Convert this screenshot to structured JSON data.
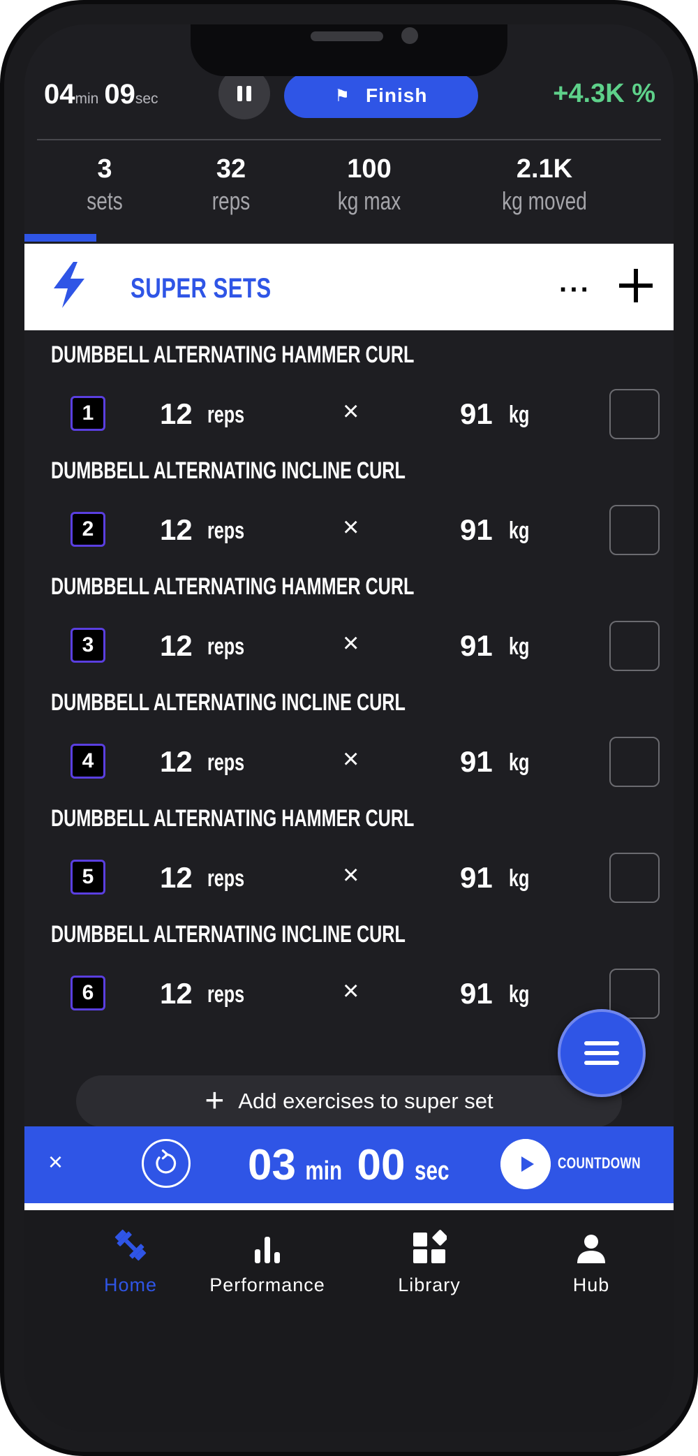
{
  "colors": {
    "accent": "#2f55e6",
    "positive": "#5ed18a",
    "background": "#1e1e22"
  },
  "topbar": {
    "timer_min": "04",
    "timer_min_unit": "min",
    "timer_sec": "09",
    "timer_sec_unit": "sec",
    "finish_label": "Finish",
    "percent": "+4.3K %"
  },
  "stats": [
    {
      "value": "3",
      "label": "sets"
    },
    {
      "value": "32",
      "label": "reps"
    },
    {
      "value": "100",
      "label": "kg max"
    },
    {
      "value": "2.1K",
      "label": "kg moved"
    }
  ],
  "section": {
    "title": "SUPER SETS",
    "more": "···"
  },
  "exercises": [
    {
      "title": "DUMBBELL ALTERNATING HAMMER CURL",
      "set": "1",
      "reps": "12",
      "reps_unit": "reps",
      "times": "×",
      "weight": "91",
      "weight_unit": "kg",
      "checked": false
    },
    {
      "title": "DUMBBELL ALTERNATING INCLINE CURL",
      "set": "2",
      "reps": "12",
      "reps_unit": "reps",
      "times": "×",
      "weight": "91",
      "weight_unit": "kg",
      "checked": false
    },
    {
      "title": "DUMBBELL ALTERNATING HAMMER CURL",
      "set": "3",
      "reps": "12",
      "reps_unit": "reps",
      "times": "×",
      "weight": "91",
      "weight_unit": "kg",
      "checked": false
    },
    {
      "title": "DUMBBELL ALTERNATING INCLINE CURL",
      "set": "4",
      "reps": "12",
      "reps_unit": "reps",
      "times": "×",
      "weight": "91",
      "weight_unit": "kg",
      "checked": false
    },
    {
      "title": "DUMBBELL ALTERNATING HAMMER CURL",
      "set": "5",
      "reps": "12",
      "reps_unit": "reps",
      "times": "×",
      "weight": "91",
      "weight_unit": "kg",
      "checked": false
    },
    {
      "title": "DUMBBELL ALTERNATING INCLINE CURL",
      "set": "6",
      "reps": "12",
      "reps_unit": "reps",
      "times": "×",
      "weight": "91",
      "weight_unit": "kg",
      "checked": false
    }
  ],
  "add_exercises_label": "Add exercises to super set",
  "countdown": {
    "close": "×",
    "min": "03",
    "min_unit": "min",
    "sec": "00",
    "sec_unit": "sec",
    "label": "COUNTDOWN"
  },
  "nav": [
    {
      "label": "Home",
      "icon": "dumbbell-icon",
      "active": true
    },
    {
      "label": "Performance",
      "icon": "bar-chart-icon",
      "active": false
    },
    {
      "label": "Library",
      "icon": "library-grid-icon",
      "active": false
    },
    {
      "label": "Hub",
      "icon": "person-icon",
      "active": false
    }
  ]
}
